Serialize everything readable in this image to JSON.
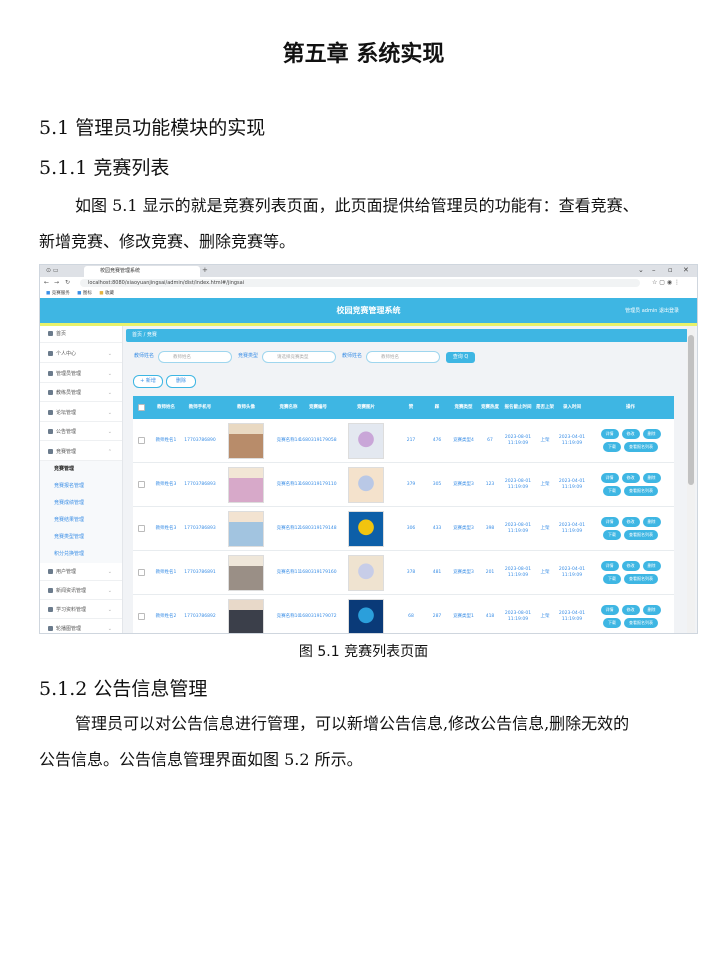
{
  "chapter_title": "第五章  系统实现",
  "section": "5.1  管理员功能模块的实现",
  "subsection1": "5.1.1  竞赛列表",
  "para1_line1": "如图 5.1 显示的就是竞赛列表页面，此页面提供给管理员的功能有：查看竞赛、",
  "para1_line2": "新增竞赛、修改竞赛、删除竞赛等。",
  "figure_caption": "图 5.1 竞赛列表页面",
  "subsection2": "5.1.2  公告信息管理",
  "para2_line1": "管理员可以对公告信息进行管理，可以新增公告信息,修改公告信息,删除无效的",
  "para2_line2": "公告信息。公告信息管理界面如图 5.2 所示。",
  "screenshot": {
    "tab_title": "校园竞赛管理系统",
    "url": "localhost:8080/xiaoyuanjingsai/admin/dist/index.html#/jingsai",
    "bookmarks": [
      "竞赛服务",
      "图标",
      "收藏"
    ],
    "app_title": "校园竞赛管理系统",
    "header_right": "管理员 admin    退出登录",
    "breadcrumb": "首页 / 竞赛",
    "sidebar": {
      "items": [
        "首页",
        "个人中心",
        "管理员管理",
        "教练员管理",
        "论坛管理",
        "公告管理",
        "竞赛管理"
      ],
      "subitems": [
        "竞赛管理",
        "竞赛报名管理",
        "竞赛成绩管理",
        "竞赛结果管理",
        "竞赛类型管理",
        "积分兑换管理"
      ],
      "items_after": [
        "用户管理",
        "新闻资讯管理",
        "学习资料管理",
        "轮播图管理"
      ]
    },
    "filters": [
      {
        "label": "教师姓名",
        "placeholder": "教师姓名"
      },
      {
        "label": "竞赛类型",
        "placeholder": "请选择竞赛类型"
      },
      {
        "label": "教师姓名",
        "placeholder": "教师姓名"
      }
    ],
    "search_label": "查询 Q",
    "add_label": "+ 新增",
    "delete_label": "删除",
    "columns": [
      "教师姓名",
      "教师手机号",
      "教师头像",
      "竞赛名称",
      "竞赛编号",
      "竞赛图片",
      "赞",
      "踩",
      "竞赛类型",
      "竞赛热度",
      "报名截止时间",
      "是否上架",
      "录入时间",
      "操作"
    ],
    "rows": [
      {
        "name": "教师姓名1",
        "phone": "17703786890",
        "title": "竞赛名称14",
        "code": "1680319179058",
        "up": "217",
        "down": "476",
        "type": "竞赛类型4",
        "hot": "67",
        "deadline": "2023-08-01 11:19:09",
        "status": "上架",
        "created": "2023-04-01 11:19:09"
      },
      {
        "name": "教师姓名3",
        "phone": "17703786893",
        "title": "竞赛名称13",
        "code": "1680319179110",
        "up": "379",
        "down": "305",
        "type": "竞赛类型3",
        "hot": "123",
        "deadline": "2023-08-01 11:19:09",
        "status": "上架",
        "created": "2023-04-01 11:19:09"
      },
      {
        "name": "教师姓名3",
        "phone": "17703786893",
        "title": "竞赛名称12",
        "code": "1680319179148",
        "up": "306",
        "down": "433",
        "type": "竞赛类型3",
        "hot": "398",
        "deadline": "2023-08-01 11:19:09",
        "status": "上架",
        "created": "2023-04-01 11:19:09"
      },
      {
        "name": "教师姓名1",
        "phone": "17703786891",
        "title": "竞赛名称11",
        "code": "1680319179160",
        "up": "378",
        "down": "481",
        "type": "竞赛类型3",
        "hot": "201",
        "deadline": "2023-08-01 11:19:09",
        "status": "上架",
        "created": "2023-04-01 11:19:09"
      },
      {
        "name": "教师姓名2",
        "phone": "17703786892",
        "title": "竞赛名称10",
        "code": "1680319179072",
        "up": "68",
        "down": "287",
        "type": "竞赛类型1",
        "hot": "418",
        "deadline": "2023-08-01 11:19:09",
        "status": "上架",
        "created": "2023-04-01 11:19:09"
      }
    ],
    "op_labels": [
      "详情",
      "修改",
      "删除",
      "下载",
      "查看报名列表"
    ]
  }
}
